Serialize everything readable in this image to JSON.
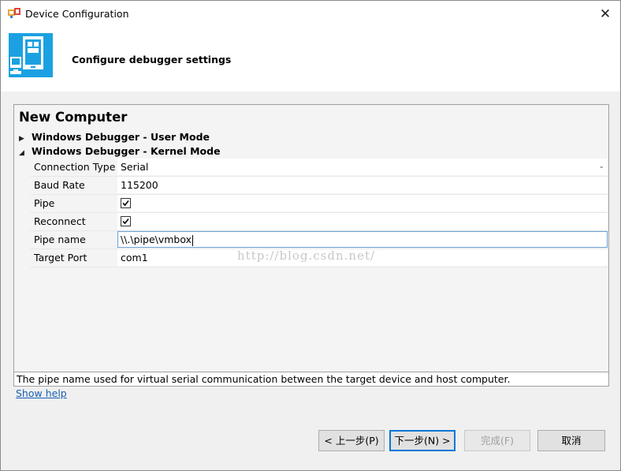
{
  "window": {
    "title": "Device Configuration"
  },
  "header": {
    "text": "Configure debugger settings"
  },
  "panel": {
    "section_title": "New Computer",
    "groups": [
      {
        "label": "Windows Debugger - User Mode",
        "expanded": false
      },
      {
        "label": "Windows Debugger - Kernel Mode",
        "expanded": true
      }
    ],
    "properties": [
      {
        "label": "Connection Type",
        "value": "Serial"
      },
      {
        "label": "Baud Rate",
        "value": "115200"
      },
      {
        "label": "Pipe",
        "checked": true
      },
      {
        "label": "Reconnect",
        "checked": true
      },
      {
        "label": "Pipe name",
        "value": "\\\\.\\pipe\\vmbox"
      },
      {
        "label": "Target Port",
        "value": "com1"
      }
    ],
    "watermark": "http://blog.csdn.net/",
    "description": "The pipe name used for virtual serial communication between the target device and host computer."
  },
  "show_help": "Show help",
  "buttons": {
    "back": "< 上一步(P)",
    "next": "下一步(N) >",
    "finish": "完成(F)",
    "cancel": "取消"
  },
  "icons": {
    "close": "close-icon",
    "app": "app-icon",
    "device": "device-computer-icon",
    "collapsed": "triangle-right-icon",
    "expanded": "triangle-down-icon",
    "dropdown": "chevron-down-icon",
    "check": "checkmark-icon"
  },
  "colors": {
    "accent": "#1ba1e2",
    "link": "#1a5fb4"
  }
}
